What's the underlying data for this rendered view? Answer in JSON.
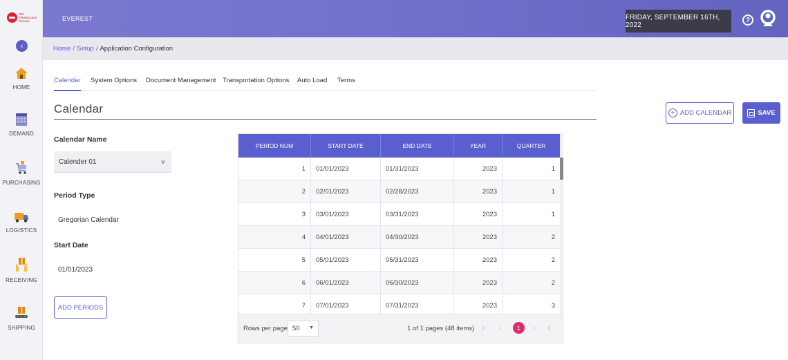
{
  "sidebar": {
    "logo_text": [
      "GSI",
      "Infrastructure",
      "Ground"
    ],
    "items": [
      {
        "label": "HOME",
        "icon": "home-icon"
      },
      {
        "label": "DEMAND",
        "icon": "calendar-grid-icon"
      },
      {
        "label": "PURCHASING",
        "icon": "shopping-cart-icon"
      },
      {
        "label": "LOGISTICS",
        "icon": "truck-icon"
      },
      {
        "label": "RECEIVING",
        "icon": "box-hands-icon"
      },
      {
        "label": "SHIPPING",
        "icon": "conveyor-box-icon"
      }
    ]
  },
  "topbar": {
    "app_name": "EVEREST",
    "date": "FRIDAY, SEPTEMBER 16TH, 2022",
    "help_glyph": "?"
  },
  "breadcrumb": {
    "home": "Home",
    "setup": "Setup",
    "current": "Application Configuration",
    "separator": "/"
  },
  "tabs": [
    {
      "label": "Calendar",
      "active": true
    },
    {
      "label": "System Options",
      "active": false
    },
    {
      "label": "Document Management",
      "active": false
    },
    {
      "label": "Transportation Options",
      "active": false
    },
    {
      "label": "Auto Load",
      "active": false
    },
    {
      "label": "Terms",
      "active": false
    }
  ],
  "section": {
    "title": "Calendar",
    "add_calendar_label": "ADD CALENDAR",
    "save_label": "SAVE"
  },
  "form": {
    "calendar_name_label": "Calendar Name",
    "calendar_name_value": "Calender 01",
    "period_type_label": "Period Type",
    "period_type_value": "Gregorian Calendar",
    "start_date_label": "Start Date",
    "start_date_value": "01/01/2023",
    "add_periods_label": "ADD PERIODS"
  },
  "grid": {
    "columns": [
      "PERIOD NUM",
      "START DATE",
      "END DATE",
      "YEAR",
      "QUARTER"
    ],
    "rows": [
      [
        "1",
        "01/01/2023",
        "01/31/2023",
        "2023",
        "1"
      ],
      [
        "2",
        "02/01/2023",
        "02/28/2023",
        "2023",
        "1"
      ],
      [
        "3",
        "03/01/2023",
        "03/31/2023",
        "2023",
        "1"
      ],
      [
        "4",
        "04/01/2023",
        "04/30/2023",
        "2023",
        "2"
      ],
      [
        "5",
        "05/01/2023",
        "05/31/2023",
        "2023",
        "2"
      ],
      [
        "6",
        "06/01/2023",
        "06/30/2023",
        "2023",
        "2"
      ],
      [
        "7",
        "07/01/2023",
        "07/31/2023",
        "2023",
        "3"
      ]
    ]
  },
  "pager": {
    "rows_per_page_label": "Rows per page",
    "rows_per_page_value": "50",
    "info": "1 of 1 pages (48 items)",
    "current_page": "1"
  },
  "colors": {
    "accent": "#5a5fd0",
    "topbar": "#6f6ecb",
    "date_box": "#3b3b4a",
    "active_page": "#e0286f"
  }
}
